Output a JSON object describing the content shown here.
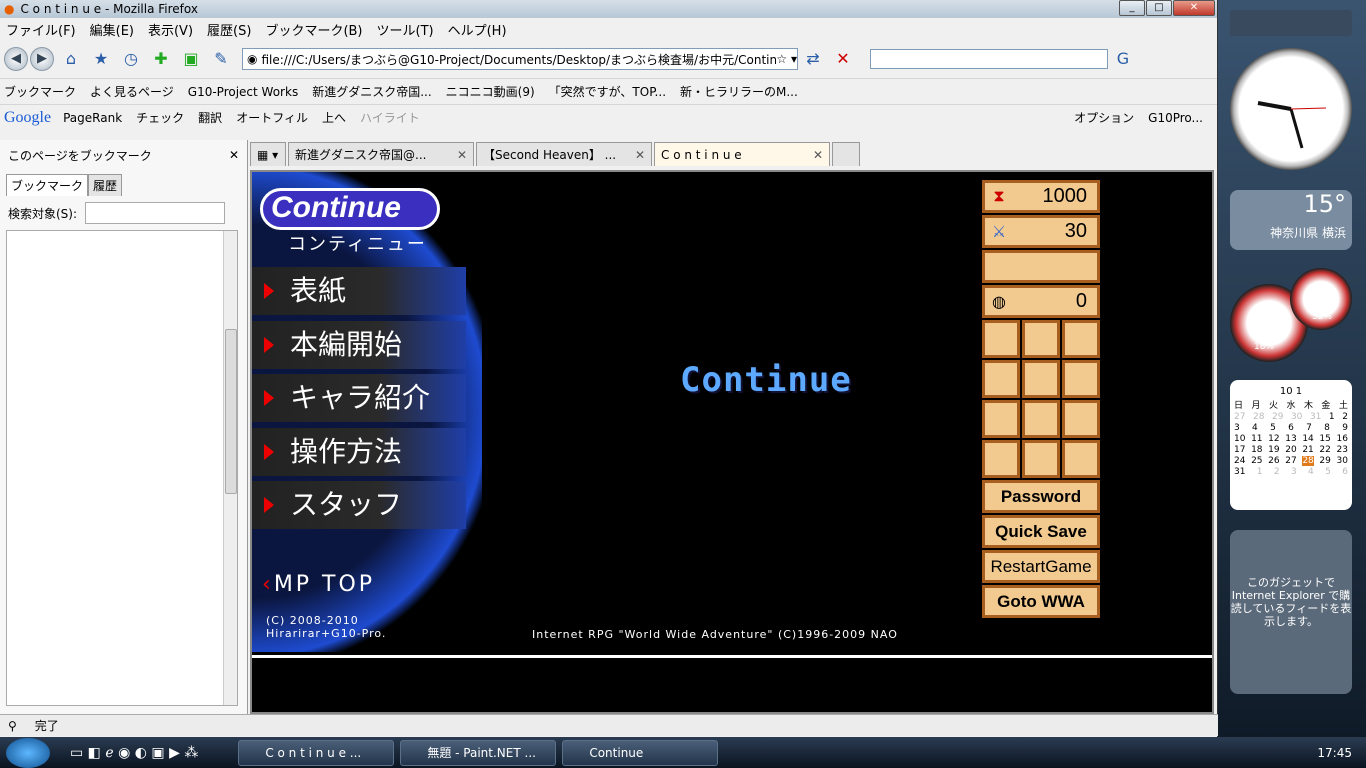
{
  "window": {
    "title": "C o n t i n u e - Mozilla Firefox"
  },
  "menu": [
    "ファイル(F)",
    "編集(E)",
    "表示(V)",
    "履歴(S)",
    "ブックマーク(B)",
    "ツール(T)",
    "ヘルプ(H)"
  ],
  "nav": {
    "url": "file:///C:/Users/まつぶら@G10-Project/Documents/Desktop/まつぶら検査場/お中元/Continue"
  },
  "bookmarks": [
    "ブックマーク",
    "よく見るページ",
    "G10-Project Works",
    "新進グダニスク帝国...",
    "ニコニコ動画(9)",
    "「突然ですが、TOP...",
    "新・ヒラリラーのM..."
  ],
  "google": {
    "logo": "Google",
    "items": [
      "PageRank",
      "チェック",
      "翻訳",
      "オートフィル",
      "上へ",
      "ハイライト"
    ],
    "right": [
      "オプション",
      "G10Pro..."
    ]
  },
  "sidebar": {
    "title": "このページをブックマーク",
    "tab1": "ブックマーク",
    "tab2": "履歴",
    "search_label": "検索対象(S):"
  },
  "tabs": [
    "新進グダニスク帝国@...",
    "【Second Heaven】 ...",
    "C o n t i n u e"
  ],
  "game": {
    "logo": "Continue",
    "logo_sub": "コンティニュー",
    "menu": [
      "表紙",
      "本編開始",
      "キャラ紹介",
      "操作方法",
      "スタッフ"
    ],
    "mptop": "MP TOP",
    "copyright1": "(C) 2008-2010",
    "copyright2": "Hirarirar+G10-Pro.",
    "credit": "Internet RPG \"World Wide Adventure\" (C)1996-2009 NAO",
    "center": "Continue",
    "hp": "1000",
    "str": "30",
    "gold": "0",
    "def": "",
    "buttons": [
      "Password",
      "Quick Save",
      "RestartGame",
      "Goto WWA"
    ]
  },
  "status": "完了",
  "taskbar": {
    "tasks": [
      "C o n t i n u e ...",
      "無題 - Paint.NET ...",
      "Continue"
    ],
    "clock": "17:45"
  },
  "gadgets": {
    "temp": "15°",
    "place": "神奈川県 横浜",
    "cpu1": "18%",
    "cpu2": "52%",
    "cal_title": "10 1",
    "feed": "このガジェットで Internet Explorer で購読しているフィードを表示します。",
    "weekdays": [
      "日",
      "月",
      "火",
      "水",
      "木",
      "金",
      "土"
    ]
  }
}
